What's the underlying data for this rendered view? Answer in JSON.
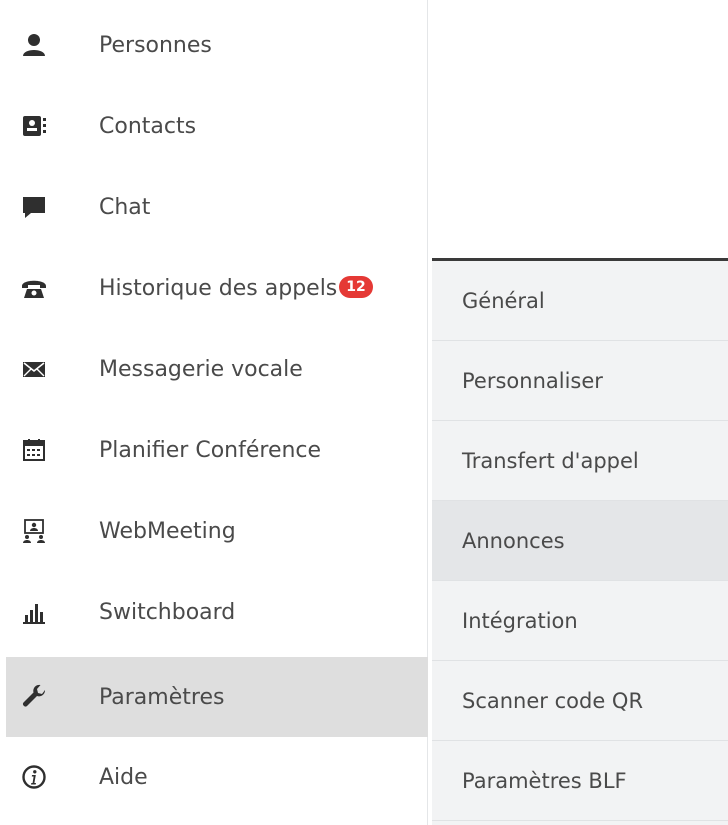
{
  "sidebar": {
    "items": [
      {
        "label": "Personnes",
        "icon": "person-icon"
      },
      {
        "label": "Contacts",
        "icon": "address-book-icon"
      },
      {
        "label": "Chat",
        "icon": "chat-bubble-icon"
      },
      {
        "label": "Historique des appels",
        "icon": "telephone-icon",
        "badge": "12"
      },
      {
        "label": "Messagerie vocale",
        "icon": "envelope-icon"
      },
      {
        "label": "Planifier Conférence",
        "icon": "calendar-icon"
      },
      {
        "label": "WebMeeting",
        "icon": "webmeeting-icon"
      },
      {
        "label": "Switchboard",
        "icon": "bar-chart-icon"
      },
      {
        "label": "Paramètres",
        "icon": "wrench-icon",
        "active": true
      },
      {
        "label": "Aide",
        "icon": "info-icon"
      }
    ]
  },
  "submenu": {
    "items": [
      {
        "label": "Général"
      },
      {
        "label": "Personnaliser"
      },
      {
        "label": "Transfert d'appel"
      },
      {
        "label": "Annonces",
        "hover": true
      },
      {
        "label": "Intégration"
      },
      {
        "label": "Scanner code QR"
      },
      {
        "label": "Paramètres BLF"
      }
    ]
  },
  "colors": {
    "badge": "#e53935",
    "active_bg": "#dedede",
    "icon": "#2f2f2f",
    "submenu_top_border": "#3a3a3a"
  }
}
